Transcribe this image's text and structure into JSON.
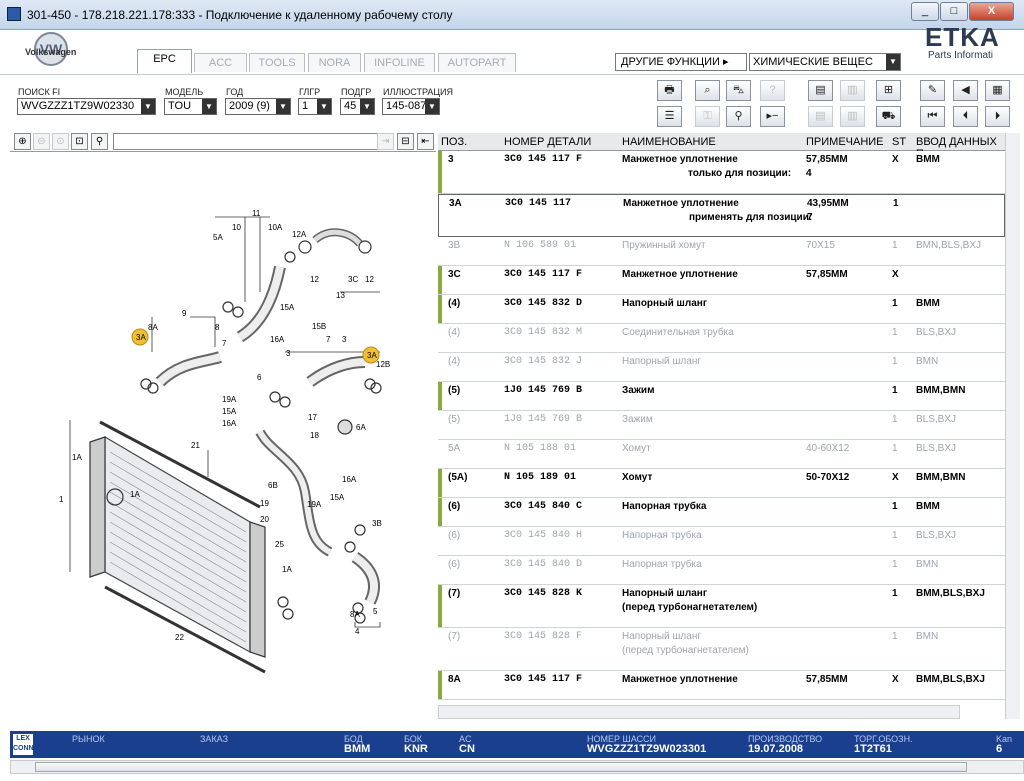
{
  "window": {
    "title": "301-450 - 178.218.221.178:333 - Подключение к удаленному рабочему столу",
    "min": "_",
    "max": "□",
    "close": "X"
  },
  "brand": {
    "vw_label": "Volkswagen",
    "vw_mark": "VW",
    "etka": "ETKA",
    "etka_sub": "Parts Informati"
  },
  "tabs": [
    {
      "label": "EPC"
    },
    {
      "label": "ACC"
    },
    {
      "label": "TOOLS"
    },
    {
      "label": "NORA"
    },
    {
      "label": "INFOLINE"
    },
    {
      "label": "AUTOPART"
    }
  ],
  "other_functions": {
    "label": "ДРУГИЕ ФУНКЦИИ ▸",
    "value": "ХИМИЧЕСКИЕ ВЕЩЕС"
  },
  "filters": {
    "search": {
      "label": "ПОИСК FI",
      "value": "WVGZZZ1TZ9W02330"
    },
    "model": {
      "label": "МОДЕЛЬ",
      "value": "TOU"
    },
    "year": {
      "label": "ГОД",
      "value": "2009 (9)"
    },
    "mg": {
      "label": "ГЛГР",
      "value": "1"
    },
    "sg": {
      "label": "ПОДГР",
      "value": "45"
    },
    "ill": {
      "label": "ИЛЛЮСТРАЦИЯ",
      "value": "145-087"
    }
  },
  "grid": {
    "headers": [
      "ПОЗ.",
      "НОМЕР ДЕТАЛИ",
      "НАИМЕНОВАНИЕ",
      "ПРИМЕЧАНИЕ",
      "ST",
      "ВВОД ДАННЫХ П"
    ],
    "rows": [
      {
        "pos": "3",
        "pn": "3C0  145  117  F",
        "name": "Манжетное уплотнение",
        "note": "57,85MM",
        "st": "X",
        "data": "BMM",
        "sub": "только для позиции:",
        "sub_val": "4",
        "style": "bold",
        "mark": true
      },
      {
        "pos": "3A",
        "pn": "3C0  145  117",
        "name": "Манжетное уплотнение",
        "note": "43,95MM",
        "st": "1",
        "data": "",
        "sub": "применять для позиции:",
        "sub_val": "7",
        "style": "bold",
        "mark": false
      },
      {
        "pos": "3B",
        "pn": "N    106  589  01",
        "name": "Пружинный хомут",
        "note": "70X15",
        "st": "1",
        "data": "BMN,BLS,BXJ",
        "style": "grey",
        "mark": false
      },
      {
        "pos": "3C",
        "pn": "3C0  145  117  F",
        "name": "Манжетное уплотнение",
        "note": "57,85MM",
        "st": "X",
        "data": "",
        "style": "bold",
        "mark": true
      },
      {
        "pos": "(4)",
        "pn": "3C0  145  832  D",
        "name": "Напорный шланг",
        "note": "",
        "st": "1",
        "data": "BMM",
        "style": "bold",
        "mark": true
      },
      {
        "pos": "(4)",
        "pn": "3C0  145  832  M",
        "name": "Соединительная трубка",
        "note": "",
        "st": "1",
        "data": "BLS,BXJ",
        "style": "grey",
        "mark": false
      },
      {
        "pos": "(4)",
        "pn": "3C0  145  832  J",
        "name": "Напорный шланг",
        "note": "",
        "st": "1",
        "data": "BMN",
        "style": "grey",
        "mark": false
      },
      {
        "pos": "(5)",
        "pn": "1J0  145  769  B",
        "name": "Зажим",
        "note": "",
        "st": "1",
        "data": "BMM,BMN",
        "style": "bold",
        "mark": true
      },
      {
        "pos": "(5)",
        "pn": "1J0  145  769  B",
        "name": "Зажим",
        "note": "",
        "st": "1",
        "data": "BLS,BXJ",
        "style": "grey",
        "mark": false
      },
      {
        "pos": "5A",
        "pn": "N    105  188  01",
        "name": "Хомут",
        "note": "40-60X12",
        "st": "1",
        "data": "BLS,BXJ",
        "style": "grey",
        "mark": false
      },
      {
        "pos": "(5A)",
        "pn": "N    105  189  01",
        "name": "Хомут",
        "note": "50-70X12",
        "st": "X",
        "data": "BMM,BMN",
        "style": "bold",
        "mark": true
      },
      {
        "pos": "(6)",
        "pn": "3C0  145  840  C",
        "name": "Напорная трубка",
        "note": "",
        "st": "1",
        "data": "BMM",
        "style": "bold",
        "mark": true
      },
      {
        "pos": "(6)",
        "pn": "3C0  145  840  H",
        "name": "Напорная трубка",
        "note": "",
        "st": "1",
        "data": "BLS,BXJ",
        "style": "grey",
        "mark": false
      },
      {
        "pos": "(6)",
        "pn": "3C0  145  840  D",
        "name": "Напорная трубка",
        "note": "",
        "st": "1",
        "data": "BMN",
        "style": "grey",
        "mark": false
      },
      {
        "pos": "(7)",
        "pn": "3C0  145  828  K",
        "name": "Напорный шланг",
        "note": "",
        "st": "1",
        "data": "BMM,BLS,BXJ",
        "sub2": "(перед турбонагнетателем)",
        "style": "bold",
        "mark": true
      },
      {
        "pos": "(7)",
        "pn": "3C0  145  828  F",
        "name": "Напорный шланг",
        "note": "",
        "st": "1",
        "data": "BMN",
        "sub2": "(перед турбонагнетателем)",
        "style": "grey",
        "mark": false
      },
      {
        "pos": "8A",
        "pn": "3C0  145  117  F",
        "name": "Манжетное уплотнение",
        "note": "57,85MM",
        "st": "X",
        "data": "BMM,BLS,BXJ",
        "style": "bold",
        "mark": true
      }
    ]
  },
  "status": {
    "lex": "LEX CONN",
    "market_label": "РЫНОК",
    "order_label": "ЗАКАЗ",
    "bod_label": "БОД",
    "bod": "BMM",
    "bok_label": "БОК",
    "bok": "KNR",
    "ac_label": "AC",
    "ac": "CN",
    "vin_label": "НОМЕР ШАССИ",
    "vin": "WVGZZZ1TZ9W023301",
    "prod_label": "ПРОИЗВОДСТВО",
    "prod": "19.07.2008",
    "trade_label": "ТОРГ.ОБОЗН.",
    "trade": "1T2T61",
    "kan_label": "Kan",
    "kan": "6"
  },
  "diagram": {
    "callouts": [
      "3A",
      "3A"
    ],
    "labels": [
      "11",
      "10",
      "10A",
      "12A",
      "5A",
      "12",
      "3C",
      "12",
      "13",
      "9",
      "8",
      "8A",
      "7",
      "15A",
      "15B",
      "16A",
      "3",
      "7",
      "12B",
      "6",
      "5",
      "19A",
      "15A",
      "16A",
      "17",
      "18",
      "6A",
      "21",
      "1A",
      "1",
      "1A",
      "6B",
      "19",
      "20",
      "16A",
      "15A",
      "19A",
      "3B",
      "25",
      "1A",
      "8A",
      "22",
      "4",
      "5",
      "3"
    ]
  }
}
